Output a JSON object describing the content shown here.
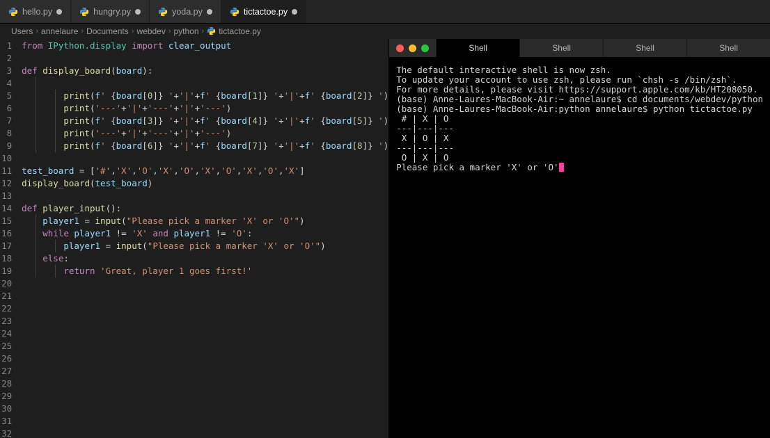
{
  "tabs": [
    {
      "name": "hello.py",
      "modified": true,
      "active": false
    },
    {
      "name": "hungry.py",
      "modified": true,
      "active": false
    },
    {
      "name": "yoda.py",
      "modified": true,
      "active": false
    },
    {
      "name": "tictactoe.py",
      "modified": true,
      "active": true
    }
  ],
  "breadcrumbs": [
    "Users",
    "annelaure",
    "Documents",
    "webdev",
    "python",
    "tictactoe.py"
  ],
  "code_lines": [
    {
      "n": 1,
      "ind": 0,
      "tokens": [
        [
          "kw",
          "from"
        ],
        [
          "op",
          " "
        ],
        [
          "mod",
          "IPython.display"
        ],
        [
          "op",
          " "
        ],
        [
          "kw",
          "import"
        ],
        [
          "op",
          " "
        ],
        [
          "id",
          "clear_output"
        ]
      ]
    },
    {
      "n": 2,
      "ind": 0,
      "tokens": []
    },
    {
      "n": 3,
      "ind": 0,
      "tokens": [
        [
          "kw",
          "def"
        ],
        [
          "op",
          " "
        ],
        [
          "def",
          "display_board"
        ],
        [
          "op",
          "("
        ],
        [
          "id",
          "board"
        ],
        [
          "op",
          "):"
        ]
      ]
    },
    {
      "n": 4,
      "ind": 1,
      "tokens": []
    },
    {
      "n": 5,
      "ind": 2,
      "tokens": [
        [
          "def",
          "print"
        ],
        [
          "op",
          "("
        ],
        [
          "id",
          "f"
        ],
        [
          "str",
          "' "
        ],
        [
          "op",
          "{"
        ],
        [
          "id",
          "board"
        ],
        [
          "op",
          "["
        ],
        [
          "num",
          "0"
        ],
        [
          "op",
          "]"
        ],
        [
          "op",
          "}"
        ],
        [
          "str",
          " '"
        ],
        [
          "op",
          "+"
        ],
        [
          "str",
          "'|'"
        ],
        [
          "op",
          "+"
        ],
        [
          "id",
          "f"
        ],
        [
          "str",
          "' "
        ],
        [
          "op",
          "{"
        ],
        [
          "id",
          "board"
        ],
        [
          "op",
          "["
        ],
        [
          "num",
          "1"
        ],
        [
          "op",
          "]"
        ],
        [
          "op",
          "}"
        ],
        [
          "str",
          " '"
        ],
        [
          "op",
          "+"
        ],
        [
          "str",
          "'|'"
        ],
        [
          "op",
          "+"
        ],
        [
          "id",
          "f"
        ],
        [
          "str",
          "' "
        ],
        [
          "op",
          "{"
        ],
        [
          "id",
          "board"
        ],
        [
          "op",
          "["
        ],
        [
          "num",
          "2"
        ],
        [
          "op",
          "]"
        ],
        [
          "op",
          "}"
        ],
        [
          "str",
          " '"
        ],
        [
          "op",
          ")"
        ]
      ]
    },
    {
      "n": 6,
      "ind": 2,
      "tokens": [
        [
          "def",
          "print"
        ],
        [
          "op",
          "("
        ],
        [
          "str",
          "'---'"
        ],
        [
          "op",
          "+"
        ],
        [
          "str",
          "'|'"
        ],
        [
          "op",
          "+"
        ],
        [
          "str",
          "'---'"
        ],
        [
          "op",
          "+"
        ],
        [
          "str",
          "'|'"
        ],
        [
          "op",
          "+"
        ],
        [
          "str",
          "'---'"
        ],
        [
          "op",
          ")"
        ]
      ]
    },
    {
      "n": 7,
      "ind": 2,
      "tokens": [
        [
          "def",
          "print"
        ],
        [
          "op",
          "("
        ],
        [
          "id",
          "f"
        ],
        [
          "str",
          "' "
        ],
        [
          "op",
          "{"
        ],
        [
          "id",
          "board"
        ],
        [
          "op",
          "["
        ],
        [
          "num",
          "3"
        ],
        [
          "op",
          "]"
        ],
        [
          "op",
          "}"
        ],
        [
          "str",
          " '"
        ],
        [
          "op",
          "+"
        ],
        [
          "str",
          "'|'"
        ],
        [
          "op",
          "+"
        ],
        [
          "id",
          "f"
        ],
        [
          "str",
          "' "
        ],
        [
          "op",
          "{"
        ],
        [
          "id",
          "board"
        ],
        [
          "op",
          "["
        ],
        [
          "num",
          "4"
        ],
        [
          "op",
          "]"
        ],
        [
          "op",
          "}"
        ],
        [
          "str",
          " '"
        ],
        [
          "op",
          "+"
        ],
        [
          "str",
          "'|'"
        ],
        [
          "op",
          "+"
        ],
        [
          "id",
          "f"
        ],
        [
          "str",
          "' "
        ],
        [
          "op",
          "{"
        ],
        [
          "id",
          "board"
        ],
        [
          "op",
          "["
        ],
        [
          "num",
          "5"
        ],
        [
          "op",
          "]"
        ],
        [
          "op",
          "}"
        ],
        [
          "str",
          " '"
        ],
        [
          "op",
          ")"
        ]
      ]
    },
    {
      "n": 8,
      "ind": 2,
      "tokens": [
        [
          "def",
          "print"
        ],
        [
          "op",
          "("
        ],
        [
          "str",
          "'---'"
        ],
        [
          "op",
          "+"
        ],
        [
          "str",
          "'|'"
        ],
        [
          "op",
          "+"
        ],
        [
          "str",
          "'---'"
        ],
        [
          "op",
          "+"
        ],
        [
          "str",
          "'|'"
        ],
        [
          "op",
          "+"
        ],
        [
          "str",
          "'---'"
        ],
        [
          "op",
          ")"
        ]
      ]
    },
    {
      "n": 9,
      "ind": 2,
      "tokens": [
        [
          "def",
          "print"
        ],
        [
          "op",
          "("
        ],
        [
          "id",
          "f"
        ],
        [
          "str",
          "' "
        ],
        [
          "op",
          "{"
        ],
        [
          "id",
          "board"
        ],
        [
          "op",
          "["
        ],
        [
          "num",
          "6"
        ],
        [
          "op",
          "]"
        ],
        [
          "op",
          "}"
        ],
        [
          "str",
          " '"
        ],
        [
          "op",
          "+"
        ],
        [
          "str",
          "'|'"
        ],
        [
          "op",
          "+"
        ],
        [
          "id",
          "f"
        ],
        [
          "str",
          "' "
        ],
        [
          "op",
          "{"
        ],
        [
          "id",
          "board"
        ],
        [
          "op",
          "["
        ],
        [
          "num",
          "7"
        ],
        [
          "op",
          "]"
        ],
        [
          "op",
          "}"
        ],
        [
          "str",
          " '"
        ],
        [
          "op",
          "+"
        ],
        [
          "str",
          "'|'"
        ],
        [
          "op",
          "+"
        ],
        [
          "id",
          "f"
        ],
        [
          "str",
          "' "
        ],
        [
          "op",
          "{"
        ],
        [
          "id",
          "board"
        ],
        [
          "op",
          "["
        ],
        [
          "num",
          "8"
        ],
        [
          "op",
          "]"
        ],
        [
          "op",
          "}"
        ],
        [
          "str",
          " '"
        ],
        [
          "op",
          ")"
        ]
      ]
    },
    {
      "n": 10,
      "ind": 0,
      "tokens": []
    },
    {
      "n": 11,
      "ind": 0,
      "tokens": [
        [
          "id",
          "test_board"
        ],
        [
          "op",
          " = ["
        ],
        [
          "str",
          "'#'"
        ],
        [
          "op",
          ","
        ],
        [
          "str",
          "'X'"
        ],
        [
          "op",
          ","
        ],
        [
          "str",
          "'O'"
        ],
        [
          "op",
          ","
        ],
        [
          "str",
          "'X'"
        ],
        [
          "op",
          ","
        ],
        [
          "str",
          "'O'"
        ],
        [
          "op",
          ","
        ],
        [
          "str",
          "'X'"
        ],
        [
          "op",
          ","
        ],
        [
          "str",
          "'O'"
        ],
        [
          "op",
          ","
        ],
        [
          "str",
          "'X'"
        ],
        [
          "op",
          ","
        ],
        [
          "str",
          "'O'"
        ],
        [
          "op",
          ","
        ],
        [
          "str",
          "'X'"
        ],
        [
          "op",
          "]"
        ]
      ]
    },
    {
      "n": 12,
      "ind": 0,
      "tokens": [
        [
          "def",
          "display_board"
        ],
        [
          "op",
          "("
        ],
        [
          "id",
          "test_board"
        ],
        [
          "op",
          ")"
        ]
      ]
    },
    {
      "n": 13,
      "ind": 0,
      "tokens": []
    },
    {
      "n": 14,
      "ind": 0,
      "tokens": [
        [
          "kw",
          "def"
        ],
        [
          "op",
          " "
        ],
        [
          "def",
          "player_input"
        ],
        [
          "op",
          "():"
        ]
      ]
    },
    {
      "n": 15,
      "ind": 1,
      "tokens": [
        [
          "id",
          "player1"
        ],
        [
          "op",
          " = "
        ],
        [
          "def",
          "input"
        ],
        [
          "op",
          "("
        ],
        [
          "str",
          "\"Please pick a marker 'X' or 'O'\""
        ],
        [
          "op",
          ")"
        ]
      ]
    },
    {
      "n": 16,
      "ind": 1,
      "tokens": [
        [
          "kw",
          "while"
        ],
        [
          "op",
          " "
        ],
        [
          "id",
          "player1"
        ],
        [
          "op",
          " != "
        ],
        [
          "str",
          "'X'"
        ],
        [
          "op",
          " "
        ],
        [
          "kw",
          "and"
        ],
        [
          "op",
          " "
        ],
        [
          "id",
          "player1"
        ],
        [
          "op",
          " != "
        ],
        [
          "str",
          "'O'"
        ],
        [
          "op",
          ":"
        ]
      ]
    },
    {
      "n": 17,
      "ind": 2,
      "tokens": [
        [
          "id",
          "player1"
        ],
        [
          "op",
          " = "
        ],
        [
          "def",
          "input"
        ],
        [
          "op",
          "("
        ],
        [
          "str",
          "\"Please pick a marker 'X' or 'O'\""
        ],
        [
          "op",
          ")"
        ]
      ]
    },
    {
      "n": 18,
      "ind": 1,
      "tokens": [
        [
          "kw",
          "else"
        ],
        [
          "op",
          ":"
        ]
      ]
    },
    {
      "n": 19,
      "ind": 2,
      "tokens": [
        [
          "kw",
          "return"
        ],
        [
          "op",
          " "
        ],
        [
          "str",
          "'Great, player 1 goes first!'"
        ]
      ]
    },
    {
      "n": 20,
      "ind": 0,
      "tokens": []
    },
    {
      "n": 21,
      "ind": 0,
      "tokens": []
    },
    {
      "n": 22,
      "ind": 0,
      "tokens": []
    },
    {
      "n": 23,
      "ind": 0,
      "tokens": []
    },
    {
      "n": 24,
      "ind": 0,
      "tokens": []
    },
    {
      "n": 25,
      "ind": 0,
      "tokens": []
    },
    {
      "n": 26,
      "ind": 0,
      "tokens": []
    },
    {
      "n": 27,
      "ind": 0,
      "tokens": []
    },
    {
      "n": 28,
      "ind": 0,
      "tokens": []
    },
    {
      "n": 29,
      "ind": 0,
      "tokens": []
    },
    {
      "n": 30,
      "ind": 0,
      "tokens": []
    },
    {
      "n": 31,
      "ind": 0,
      "tokens": []
    },
    {
      "n": 32,
      "ind": 0,
      "tokens": []
    }
  ],
  "terminal": {
    "tabs": [
      "Shell",
      "Shell",
      "Shell",
      "Shell"
    ],
    "active_tab": 0,
    "lines": [
      "The default interactive shell is now zsh.",
      "To update your account to use zsh, please run `chsh -s /bin/zsh`.",
      "For more details, please visit https://support.apple.com/kb/HT208050.",
      "(base) Anne-Laures-MacBook-Air:~ annelaure$ cd documents/webdev/python",
      "(base) Anne-Laures-MacBook-Air:python annelaure$ python tictactoe.py",
      " # | X | O ",
      "---|---|---",
      " X | O | X ",
      "---|---|---",
      " O | X | O ",
      "Please pick a marker 'X' or 'O'"
    ]
  }
}
